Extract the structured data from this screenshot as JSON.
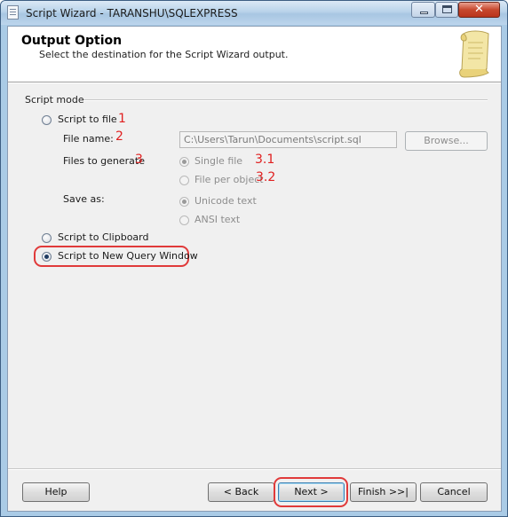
{
  "window": {
    "title": "Script Wizard - TARANSHU\\SQLEXPRESS",
    "close_glyph": "✕"
  },
  "header": {
    "title": "Output Option",
    "subtitle": "Select the destination for the Script Wizard output."
  },
  "script_mode": {
    "group_label": "Script mode",
    "to_file": {
      "label": "Script to file",
      "annotation": "1",
      "selected": false
    },
    "file_name": {
      "label": "File name:",
      "annotation": "2",
      "value": "C:\\Users\\Tarun\\Documents\\script.sql",
      "browse_label": "Browse..."
    },
    "files_to_generate": {
      "label": "Files to generate",
      "annotation": "3",
      "single_file": {
        "label": "Single file",
        "annotation": "3.1",
        "selected": true
      },
      "file_per_object": {
        "label": "File per object",
        "annotation": "3.2",
        "selected": false
      }
    },
    "save_as": {
      "label": "Save as:",
      "unicode": {
        "label": "Unicode text",
        "selected": true
      },
      "ansi": {
        "label": "ANSI text",
        "selected": false
      }
    },
    "to_clipboard": {
      "label": "Script to Clipboard",
      "selected": false
    },
    "to_new_query_window": {
      "label": "Script to New Query Window",
      "selected": true
    }
  },
  "footer": {
    "help": "Help",
    "back": "< Back",
    "next": "Next >",
    "finish": "Finish >>|",
    "cancel": "Cancel"
  },
  "colors": {
    "annotation": "#e02020",
    "title_bar": "#b9d3ea"
  }
}
